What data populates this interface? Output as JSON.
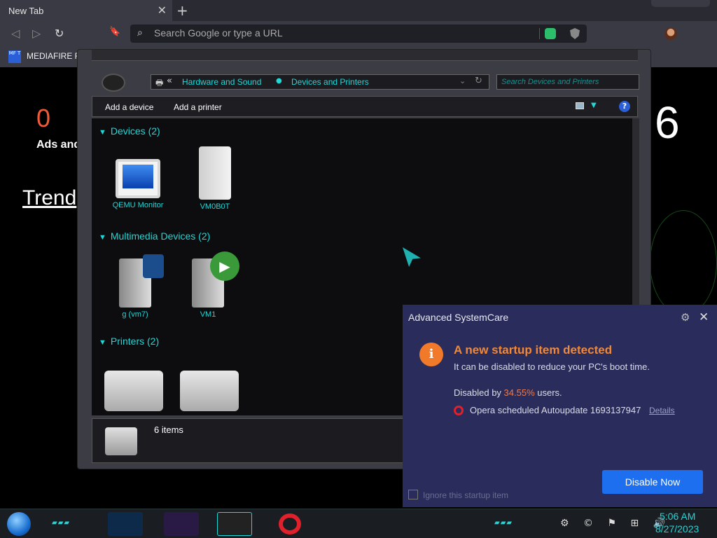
{
  "browser": {
    "tab_title": "New Tab",
    "tab_close": "✕",
    "new_tab": "+",
    "back_glyph": "◁",
    "forward_glyph": "▷",
    "reload_glyph": "↻",
    "bookmark_glyph": "🔖",
    "menu_glyph": "☰",
    "omnibox_placeholder": "Search Google or type a URL",
    "bookmark_icon_text": "MF T",
    "bookmark_label": "MEDIAFIRE RO"
  },
  "page": {
    "counter": "0",
    "counter_label": "Ads and",
    "trend_label": "Trend",
    "right_number": "6"
  },
  "explorer": {
    "address_back": "«",
    "breadcrumb": [
      "Hardware and Sound",
      "Devices and Printers"
    ],
    "search_placeholder": "Search Devices and Printers",
    "commands": [
      "Add a device",
      "Add a printer"
    ],
    "help_glyph": "?",
    "groups": [
      {
        "label": "Devices (2)",
        "items": [
          "QEMU Monitor",
          "VM0B0T"
        ]
      },
      {
        "label": "Multimedia Devices (2)",
        "items": [
          "g (vm7)",
          "VM1"
        ]
      },
      {
        "label": "Printers (2)",
        "items": [
          "",
          ""
        ]
      }
    ],
    "status_items": "6 items"
  },
  "notification": {
    "app_title": "Advanced SystemCare",
    "headline": "A new startup item detected",
    "subtext": "It can be disabled to reduce your PC's boot time.",
    "stat_prefix": "Disabled by ",
    "stat_percent": "34.55%",
    "stat_suffix": " users.",
    "item_name": "Opera scheduled Autoupdate 1693137947",
    "details_link": "Details",
    "checkbox_label": "Ignore this startup item",
    "button_label": "Disable Now",
    "alert_glyph": "i"
  },
  "taskbar": {
    "time": "5:06 AM",
    "date": "8/27/2023",
    "tray_glyphs": "⚙ © ⚑ ⊞ 🔊"
  },
  "colors": {
    "accent_cyan": "#1fd8d8",
    "alert_orange": "#f07a2a",
    "button_blue": "#1e6ff0",
    "opera_red": "#e0202a"
  }
}
